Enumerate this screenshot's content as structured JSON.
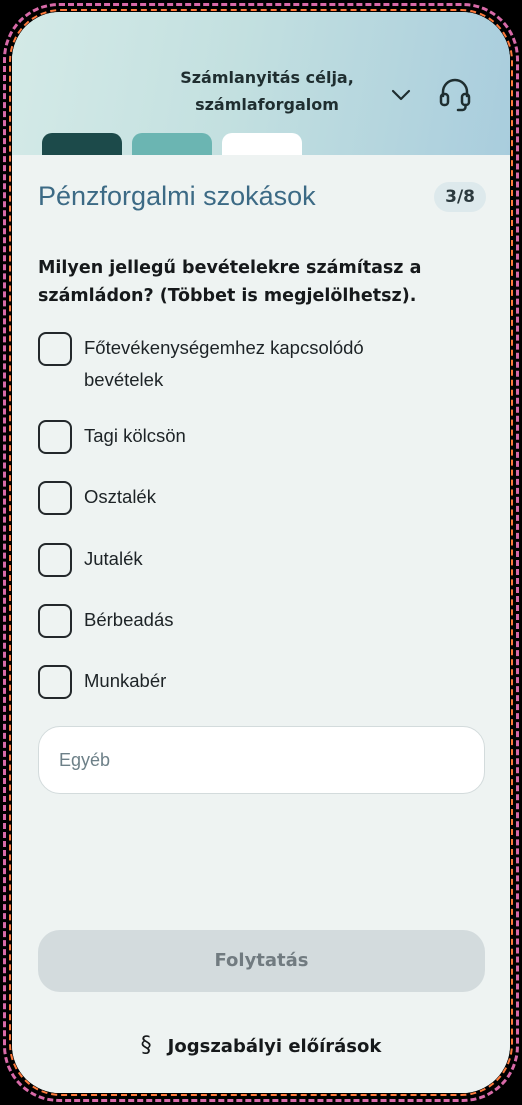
{
  "header": {
    "title_line1": "Számlanyitás célja,",
    "title_line2": "számlaforgalom",
    "dropdown_icon": "chevron-down-icon",
    "support_icon": "headset-icon",
    "progress_tabs": [
      {
        "state": "completed",
        "color": "#1c4a4a"
      },
      {
        "state": "completed",
        "color": "#6bb5b2"
      },
      {
        "state": "current",
        "color": "#ffffff"
      }
    ]
  },
  "section": {
    "title": "Pénzforgalmi szokások",
    "step": "3/8"
  },
  "question": "Milyen jellegű bevételekre számítasz a számládon? (Többet is megjelölhetsz).",
  "options": [
    {
      "label": "Főtevékenységemhez kapcsolódó bevételek",
      "checked": false
    },
    {
      "label": "Tagi kölcsön",
      "checked": false
    },
    {
      "label": "Osztalék",
      "checked": false
    },
    {
      "label": "Jutalék",
      "checked": false
    },
    {
      "label": "Bérbeadás",
      "checked": false
    },
    {
      "label": "Munkabér",
      "checked": false
    }
  ],
  "other_input": {
    "placeholder": "Egyéb",
    "value": ""
  },
  "continue_button": {
    "label": "Folytatás",
    "enabled": false
  },
  "legal_link": {
    "icon": "paragraph-icon",
    "symbol": "§",
    "label": "Jogszabályi előírások"
  },
  "colors": {
    "accent_title": "#3c6a85",
    "background": "#eef3f2"
  }
}
